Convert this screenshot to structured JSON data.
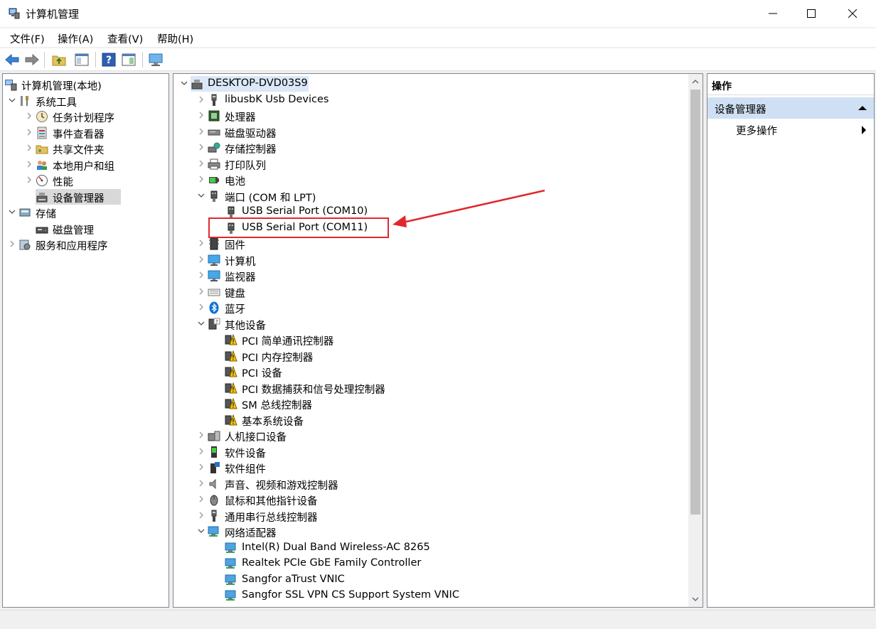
{
  "window": {
    "title": "计算机管理",
    "icon": "computer-management-icon"
  },
  "menu": [
    "文件(F)",
    "操作(A)",
    "查看(V)",
    "帮助(H)"
  ],
  "toolbar": [
    "back-arrow-icon",
    "forward-arrow-icon",
    "up-folder-icon",
    "show-hide-tree-icon",
    "help-icon",
    "properties-icon",
    "monitor-icon"
  ],
  "left_tree": [
    {
      "label": "计算机管理(本地)",
      "icon": "computer-management-icon",
      "expander": "none"
    },
    {
      "label": "系统工具",
      "icon": "tools-icon",
      "expander": "down"
    },
    {
      "label": "任务计划程序",
      "icon": "clock-icon",
      "expander": "right"
    },
    {
      "label": "事件查看器",
      "icon": "event-viewer-icon",
      "expander": "right"
    },
    {
      "label": "共享文件夹",
      "icon": "shared-folder-icon",
      "expander": "right"
    },
    {
      "label": "本地用户和组",
      "icon": "users-icon",
      "expander": "right"
    },
    {
      "label": "性能",
      "icon": "performance-icon",
      "expander": "right"
    },
    {
      "label": "设备管理器",
      "icon": "device-manager-icon",
      "expander": "none",
      "selected": true
    },
    {
      "label": "存储",
      "icon": "storage-icon",
      "expander": "down"
    },
    {
      "label": "磁盘管理",
      "icon": "disk-icon",
      "expander": "none"
    },
    {
      "label": "服务和应用程序",
      "icon": "services-icon",
      "expander": "right"
    }
  ],
  "device_tree": [
    {
      "label": "DESKTOP-DVD03S9",
      "icon": "computer-icon",
      "expander": "down"
    },
    {
      "label": "libusbK Usb Devices",
      "icon": "usb-icon",
      "expander": "right"
    },
    {
      "label": "处理器",
      "icon": "cpu-icon",
      "expander": "right"
    },
    {
      "label": "磁盘驱动器",
      "icon": "disk-drive-icon",
      "expander": "right"
    },
    {
      "label": "存储控制器",
      "icon": "storage-controller-icon",
      "expander": "right"
    },
    {
      "label": "打印队列",
      "icon": "printer-icon",
      "expander": "right"
    },
    {
      "label": "电池",
      "icon": "battery-icon",
      "expander": "right"
    },
    {
      "label": "端口 (COM 和 LPT)",
      "icon": "port-icon",
      "expander": "down"
    },
    {
      "label": "USB Serial Port (COM10)",
      "icon": "port-icon",
      "expander": "none"
    },
    {
      "label": "USB Serial Port (COM11)",
      "icon": "port-icon",
      "expander": "none"
    },
    {
      "label": "固件",
      "icon": "firmware-icon",
      "expander": "right"
    },
    {
      "label": "计算机",
      "icon": "monitor-icon",
      "expander": "right"
    },
    {
      "label": "监视器",
      "icon": "monitor-icon",
      "expander": "right"
    },
    {
      "label": "键盘",
      "icon": "keyboard-icon",
      "expander": "right"
    },
    {
      "label": "蓝牙",
      "icon": "bluetooth-icon",
      "expander": "right"
    },
    {
      "label": "其他设备",
      "icon": "other-device-icon",
      "expander": "down"
    },
    {
      "label": "PCI 简单通讯控制器",
      "icon": "warning-device-icon",
      "expander": "none"
    },
    {
      "label": "PCI 内存控制器",
      "icon": "warning-device-icon",
      "expander": "none"
    },
    {
      "label": "PCI 设备",
      "icon": "warning-device-icon",
      "expander": "none"
    },
    {
      "label": "PCI 数据捕获和信号处理控制器",
      "icon": "warning-device-icon",
      "expander": "none"
    },
    {
      "label": "SM 总线控制器",
      "icon": "warning-device-icon",
      "expander": "none"
    },
    {
      "label": "基本系统设备",
      "icon": "warning-device-icon",
      "expander": "none"
    },
    {
      "label": "人机接口设备",
      "icon": "hid-icon",
      "expander": "right"
    },
    {
      "label": "软件设备",
      "icon": "software-device-icon",
      "expander": "right"
    },
    {
      "label": "软件组件",
      "icon": "software-component-icon",
      "expander": "right"
    },
    {
      "label": "声音、视频和游戏控制器",
      "icon": "speaker-icon",
      "expander": "right"
    },
    {
      "label": "鼠标和其他指针设备",
      "icon": "mouse-icon",
      "expander": "right"
    },
    {
      "label": "通用串行总线控制器",
      "icon": "usb-icon",
      "expander": "right"
    },
    {
      "label": "网络适配器",
      "icon": "network-icon",
      "expander": "down"
    },
    {
      "label": "Intel(R) Dual Band Wireless-AC 8265",
      "icon": "network-icon",
      "expander": "none"
    },
    {
      "label": "Realtek PCIe GbE Family Controller",
      "icon": "network-icon",
      "expander": "none"
    },
    {
      "label": "Sangfor aTrust VNIC",
      "icon": "network-icon",
      "expander": "none"
    },
    {
      "label": "Sangfor SSL VPN CS Support System VNIC",
      "icon": "network-icon",
      "expander": "none"
    }
  ],
  "actions": {
    "header": "操作",
    "section": "设备管理器",
    "more": "更多操作"
  },
  "colors": {
    "highlight_box": "#e0282e",
    "arrow": "#e0282e",
    "selected_bg": "#d9d9d9",
    "actions_section_bg": "#cfe0f4"
  }
}
